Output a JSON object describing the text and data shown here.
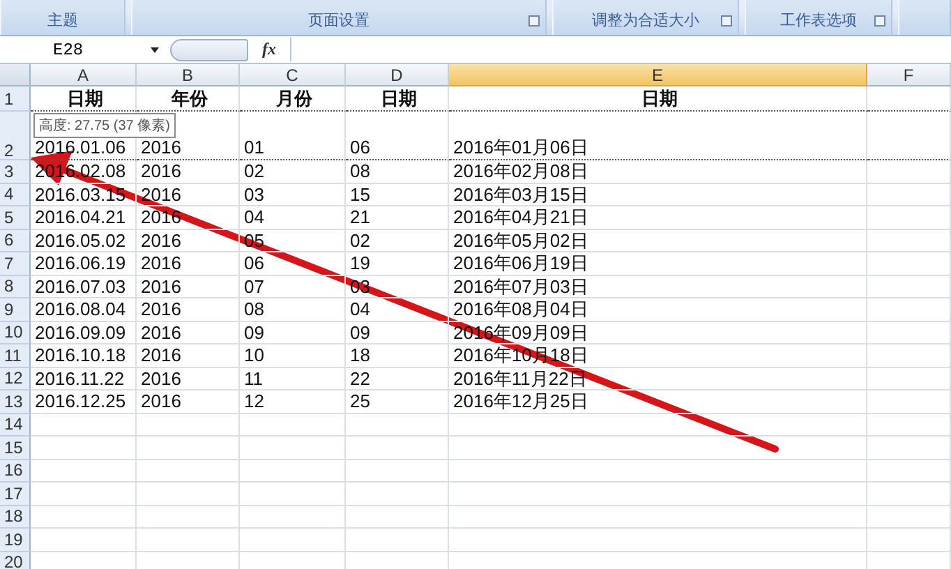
{
  "ribbon_groups": [
    {
      "label": "主题",
      "launcher": false
    },
    {
      "label": "页面设置",
      "launcher": true
    },
    {
      "label": "调整为合适大小",
      "launcher": true
    },
    {
      "label": "工作表选项",
      "launcher": true
    }
  ],
  "formula_bar": {
    "name_box": "E28",
    "function_button": "fx"
  },
  "columns": [
    {
      "label": "A",
      "selected": false
    },
    {
      "label": "B",
      "selected": false
    },
    {
      "label": "C",
      "selected": false
    },
    {
      "label": "D",
      "selected": false
    },
    {
      "label": "E",
      "selected": true
    },
    {
      "label": "F",
      "selected": false
    }
  ],
  "rows": [
    {
      "number": "1",
      "kind": "header",
      "cells": [
        "日期",
        "年份",
        "月份",
        "日期",
        "日期"
      ]
    },
    {
      "number": "2",
      "kind": "data",
      "resizing": true,
      "tooltip": "高度: 27.75 (37 像素)",
      "cells": [
        "2016.01.06",
        "2016",
        "01",
        "06",
        "2016年01月06日"
      ]
    },
    {
      "number": "3",
      "kind": "data",
      "cells": [
        "2016.02.08",
        "2016",
        "02",
        "08",
        "2016年02月08日"
      ]
    },
    {
      "number": "4",
      "kind": "data",
      "cells": [
        "2016.03.15",
        "2016",
        "03",
        "15",
        "2016年03月15日"
      ]
    },
    {
      "number": "5",
      "kind": "data",
      "cells": [
        "2016.04.21",
        "2016",
        "04",
        "21",
        "2016年04月21日"
      ]
    },
    {
      "number": "6",
      "kind": "data",
      "cells": [
        "2016.05.02",
        "2016",
        "05",
        "02",
        "2016年05月02日"
      ]
    },
    {
      "number": "7",
      "kind": "data",
      "cells": [
        "2016.06.19",
        "2016",
        "06",
        "19",
        "2016年06月19日"
      ]
    },
    {
      "number": "8",
      "kind": "data",
      "cells": [
        "2016.07.03",
        "2016",
        "07",
        "03",
        "2016年07月03日"
      ]
    },
    {
      "number": "9",
      "kind": "data",
      "cells": [
        "2016.08.04",
        "2016",
        "08",
        "04",
        "2016年08月04日"
      ]
    },
    {
      "number": "10",
      "kind": "data",
      "cells": [
        "2016.09.09",
        "2016",
        "09",
        "09",
        "2016年09月09日"
      ]
    },
    {
      "number": "11",
      "kind": "data",
      "cells": [
        "2016.10.18",
        "2016",
        "10",
        "18",
        "2016年10月18日"
      ]
    },
    {
      "number": "12",
      "kind": "data",
      "cells": [
        "2016.11.22",
        "2016",
        "11",
        "22",
        "2016年11月22日"
      ]
    },
    {
      "number": "13",
      "kind": "data",
      "cells": [
        "2016.12.25",
        "2016",
        "12",
        "25",
        "2016年12月25日"
      ]
    },
    {
      "number": "14",
      "kind": "data"
    },
    {
      "number": "15",
      "kind": "data"
    },
    {
      "number": "16",
      "kind": "data"
    },
    {
      "number": "17",
      "kind": "data"
    },
    {
      "number": "18",
      "kind": "data"
    },
    {
      "number": "19",
      "kind": "data"
    },
    {
      "number": "20",
      "kind": "data"
    }
  ],
  "annotation": {
    "kind": "arrow"
  }
}
